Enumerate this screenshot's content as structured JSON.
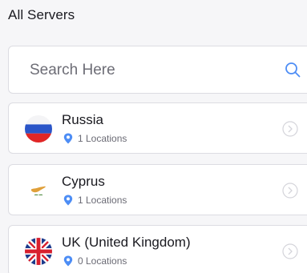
{
  "header": {
    "title": "All Servers"
  },
  "search": {
    "placeholder": "Search Here",
    "icon": "search-icon"
  },
  "colors": {
    "accent": "#4d8df5",
    "chevron": "#d4d4da",
    "border": "#dcdce2"
  },
  "servers": [
    {
      "name": "Russia",
      "locations": "1 Locations",
      "flag": "russia-flag-icon"
    },
    {
      "name": "Cyprus",
      "locations": "1 Locations",
      "flag": "cyprus-flag-icon"
    },
    {
      "name": "UK (United Kingdom)",
      "locations": "0 Locations",
      "flag": "uk-flag-icon"
    }
  ]
}
